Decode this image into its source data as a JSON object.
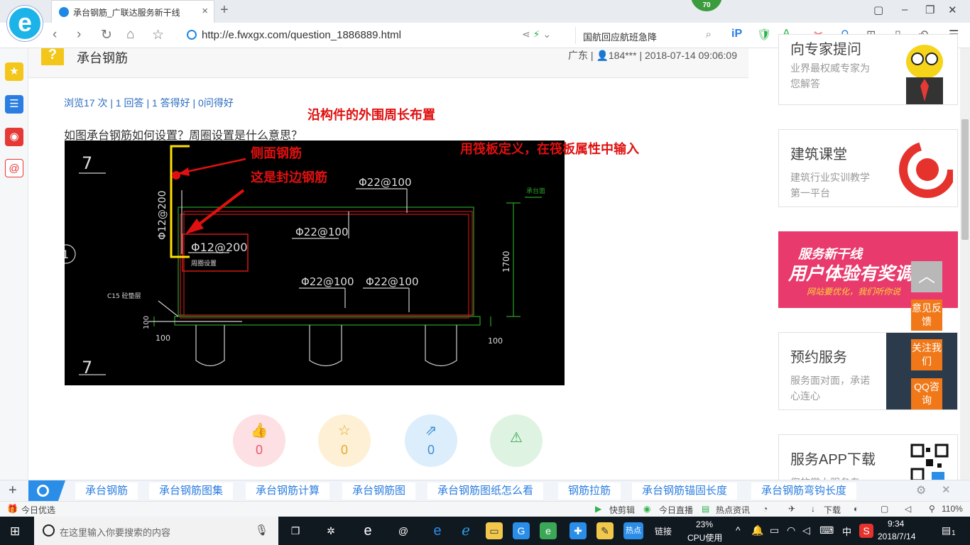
{
  "browser": {
    "tab_title": "承台钢筋_广联达服务新干线",
    "tab_close": "×",
    "new_tab": "+",
    "badge": "70",
    "url": "http://e.fwxgx.com/question_1886889.html",
    "news_search": "国航回应航班急降",
    "window": {
      "restore": "▢",
      "min": "–",
      "max": "❐",
      "close": "✕"
    }
  },
  "question": {
    "title": "承台钢筋",
    "meta": "广东 | 👤184*** | 2018-07-14 09:06:09",
    "stats": "浏览17 次 | 1 回答 | 1 答得好 | 0问得好",
    "text": "如图承台钢筋如何设置？周圈设置是什么意思？",
    "annotations": {
      "top": "沿构件的外围周长布置",
      "side": "侧面钢筋",
      "edge": "这是封边钢筋",
      "raft": "用筏板定义，在筏板属性中输入"
    },
    "cad": {
      "rebar_top": "Φ22@100",
      "rebar_mid": "Φ22@100",
      "rebar_bl": "Φ22@100",
      "rebar_br": "Φ22@100",
      "side_rebar": "Φ12@200",
      "side_vertical": "Φ12@200",
      "perimeter_label": "周圈设置",
      "height_dim": "1700",
      "dim_left": "100",
      "dim_right": "100",
      "dim_left2": "100",
      "cushion": "C15 砼垫层",
      "axis_top": "7",
      "axis_bottom": "7",
      "axis_circle": "1",
      "grade": "承台面"
    },
    "actions": {
      "like": "0",
      "favorite": "0",
      "share": "0"
    }
  },
  "sidebar_cards": [
    {
      "title": "向专家提问",
      "sub": "业界最权威专家为您解答"
    },
    {
      "title": "建筑课堂",
      "sub": "建筑行业实训教学第一平台"
    },
    {
      "title": "预约服务",
      "sub": "服务面对面，承诺心连心"
    },
    {
      "title": "服务APP下载",
      "sub": "您的掌上服务专"
    }
  ],
  "banner": {
    "line1": "服务新干线",
    "line2": "用户体验有奖调研",
    "line3": "网站要优化，我们听你说"
  },
  "float_buttons": [
    "意见反馈",
    "关注我们",
    "QQ咨询"
  ],
  "back_top": "︿",
  "related_tags": [
    "承台钢筋",
    "承台钢筋图集",
    "承台钢筋计算",
    "承台钢筋图",
    "承台钢筋图纸怎么看",
    "钢筋拉筋",
    "承台钢筋锚固长度",
    "承台钢筋弯钩长度"
  ],
  "related_icons": {
    "plus": "+",
    "settings": "⚙",
    "close": "✕"
  },
  "statusbar": {
    "today": "今日优选",
    "clip": "快剪辑",
    "live": "今日直播",
    "hot": "热点资讯",
    "download": "下载",
    "zoom": "110%"
  },
  "taskbar": {
    "search_placeholder": "在这里输入你要搜索的内容",
    "hot_icon": "热点",
    "link": "链接",
    "cpu_pct": "23%",
    "cpu_label": "CPU使用",
    "ime": "中",
    "time": "9:34",
    "date": "2018/7/14",
    "notif": "1"
  }
}
